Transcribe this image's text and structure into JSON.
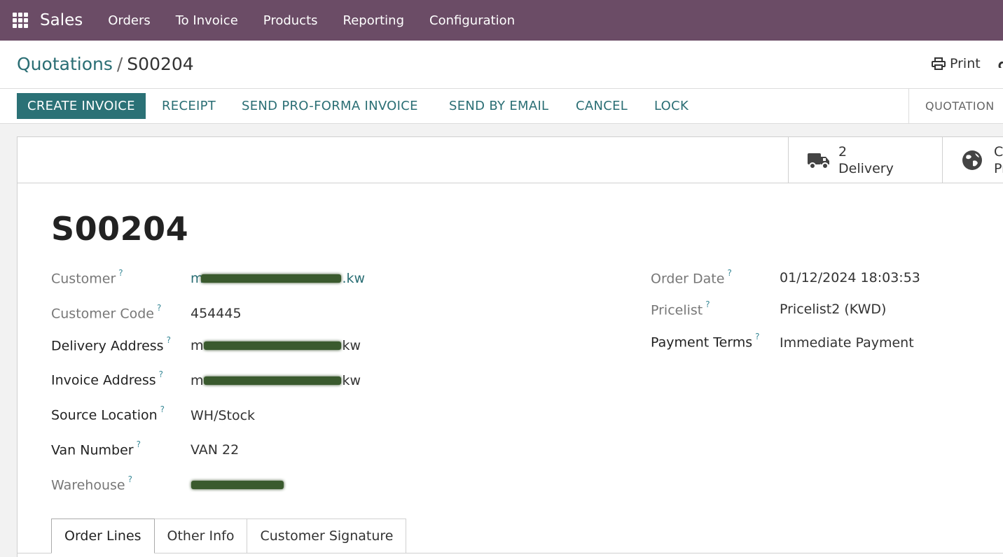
{
  "navbar": {
    "brand": "Sales",
    "items": [
      "Orders",
      "To Invoice",
      "Products",
      "Reporting",
      "Configuration"
    ]
  },
  "breadcrumb": {
    "parent": "Quotations",
    "separator": "/",
    "current": "S00204"
  },
  "actions": {
    "print_label": "Print"
  },
  "statusbar": {
    "buttons": [
      "CREATE INVOICE",
      "RECEIPT",
      "SEND PRO-FORMA INVOICE",
      "SEND BY EMAIL",
      "CANCEL",
      "LOCK"
    ],
    "status": "QUOTATION"
  },
  "smart_buttons": {
    "delivery": {
      "count": "2",
      "label": "Delivery"
    },
    "customer_preview": {
      "line1": "Cu",
      "line2": "Pr"
    }
  },
  "record": {
    "name": "S00204"
  },
  "fields_left": {
    "customer": {
      "label": "Customer",
      "value_start": "m",
      "value_end": ".kw"
    },
    "customer_code": {
      "label": "Customer Code",
      "value": "454445"
    },
    "delivery_address": {
      "label": "Delivery Address",
      "value_start": "m",
      "value_end": "kw"
    },
    "invoice_address": {
      "label": "Invoice Address",
      "value_start": "m",
      "value_end": "kw"
    },
    "source_location": {
      "label": "Source Location",
      "value": "WH/Stock"
    },
    "van_number": {
      "label": "Van Number",
      "value": "VAN 22"
    },
    "warehouse": {
      "label": "Warehouse"
    }
  },
  "fields_right": {
    "order_date": {
      "label": "Order Date",
      "value": "01/12/2024 18:03:53"
    },
    "pricelist": {
      "label": "Pricelist",
      "value": "Pricelist2 (KWD)"
    },
    "payment_terms": {
      "label": "Payment Terms",
      "value": "Immediate Payment"
    }
  },
  "help_marker": "?",
  "tabs": [
    "Order Lines",
    "Other Info",
    "Customer Signature"
  ],
  "colors": {
    "navbar": "#6b4c66",
    "primary": "#2b7176",
    "link": "#2a6e74"
  }
}
